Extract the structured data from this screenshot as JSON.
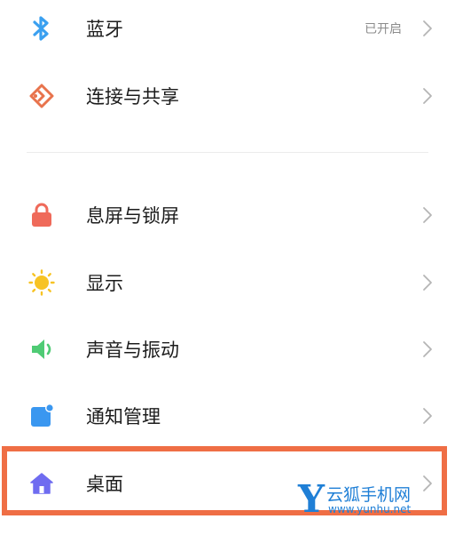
{
  "settings": {
    "bluetooth": {
      "label": "蓝牙",
      "status": "已开启",
      "icon": "bluetooth-icon"
    },
    "connection_sharing": {
      "label": "连接与共享",
      "icon": "connection-share-icon"
    },
    "lock_screen": {
      "label": "息屏与锁屏",
      "icon": "lock-icon"
    },
    "display": {
      "label": "显示",
      "icon": "sun-icon"
    },
    "sound_vibration": {
      "label": "声音与振动",
      "icon": "speaker-icon"
    },
    "notifications": {
      "label": "通知管理",
      "icon": "notification-icon"
    },
    "desktop": {
      "label": "桌面",
      "icon": "home-icon"
    }
  },
  "watermark": {
    "letter": "Y",
    "name": "云狐手机网",
    "url": "www.yunhu.net"
  },
  "colors": {
    "bluetooth": "#3aa0f0",
    "connection": "#e8734c",
    "lock": "#ef6a5a",
    "display": "#f7c324",
    "sound": "#4fcb74",
    "notification": "#3a97f0",
    "home": "#6f6cf0",
    "highlight": "#ef6e45",
    "watermark": "#1f7fd6"
  }
}
